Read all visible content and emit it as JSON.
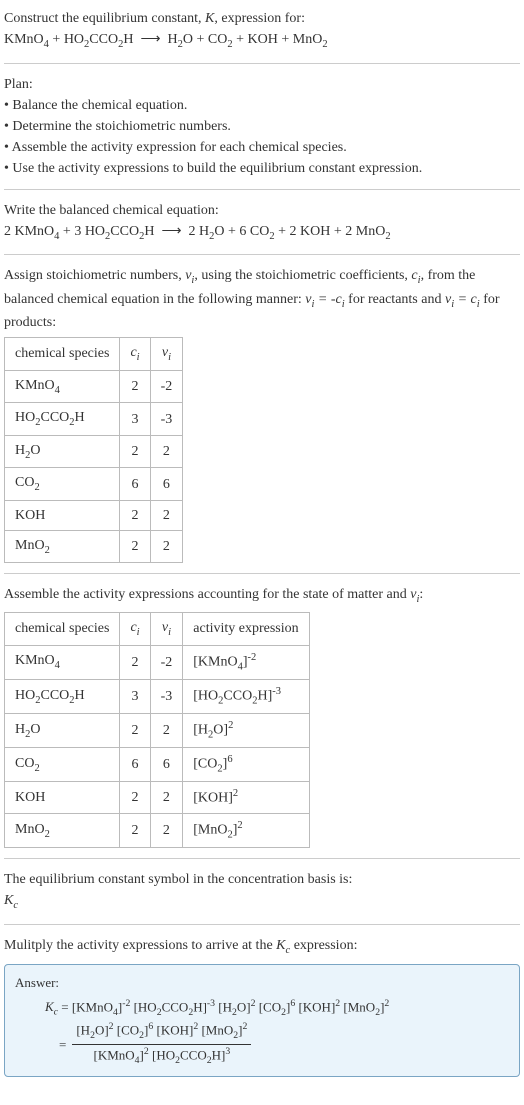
{
  "intro": {
    "line1_pre": "Construct the equilibrium constant, ",
    "line1_k": "K",
    "line1_post": ", expression for:",
    "eq_lhs": "KMnO₄ + HO₂CCO₂H",
    "eq_rhs": "H₂O + CO₂ + KOH + MnO₂"
  },
  "plan": {
    "title": "Plan:",
    "b1": "• Balance the chemical equation.",
    "b2": "• Determine the stoichiometric numbers.",
    "b3": "• Assemble the activity expression for each chemical species.",
    "b4": "• Use the activity expressions to build the equilibrium constant expression."
  },
  "balanced": {
    "title": "Write the balanced chemical equation:",
    "lhs": "2 KMnO₄ + 3 HO₂CCO₂H",
    "rhs": "2 H₂O + 6 CO₂ + 2 KOH + 2 MnO₂"
  },
  "stoich": {
    "intro_a": "Assign stoichiometric numbers, ",
    "intro_b": ", using the stoichiometric coefficients, ",
    "intro_c": ", from the balanced chemical equation in the following manner: ",
    "intro_d": " for reactants and ",
    "intro_e": " for products:",
    "headers": {
      "species": "chemical species",
      "ci": "cᵢ",
      "vi": "νᵢ"
    },
    "rows": [
      {
        "sp": "KMnO₄",
        "c": "2",
        "v": "-2"
      },
      {
        "sp": "HO₂CCO₂H",
        "c": "3",
        "v": "-3"
      },
      {
        "sp": "H₂O",
        "c": "2",
        "v": "2"
      },
      {
        "sp": "CO₂",
        "c": "6",
        "v": "6"
      },
      {
        "sp": "KOH",
        "c": "2",
        "v": "2"
      },
      {
        "sp": "MnO₂",
        "c": "2",
        "v": "2"
      }
    ]
  },
  "activity": {
    "intro_a": "Assemble the activity expressions accounting for the state of matter and ",
    "intro_b": ":",
    "headers": {
      "species": "chemical species",
      "ci": "cᵢ",
      "vi": "νᵢ",
      "act": "activity expression"
    },
    "rows": [
      {
        "sp": "KMnO₄",
        "c": "2",
        "v": "-2",
        "base": "[KMnO₄]",
        "exp": "-2"
      },
      {
        "sp": "HO₂CCO₂H",
        "c": "3",
        "v": "-3",
        "base": "[HO₂CCO₂H]",
        "exp": "-3"
      },
      {
        "sp": "H₂O",
        "c": "2",
        "v": "2",
        "base": "[H₂O]",
        "exp": "2"
      },
      {
        "sp": "CO₂",
        "c": "6",
        "v": "6",
        "base": "[CO₂]",
        "exp": "6"
      },
      {
        "sp": "KOH",
        "c": "2",
        "v": "2",
        "base": "[KOH]",
        "exp": "2"
      },
      {
        "sp": "MnO₂",
        "c": "2",
        "v": "2",
        "base": "[MnO₂]",
        "exp": "2"
      }
    ]
  },
  "kc_symbol": {
    "line": "The equilibrium constant symbol in the concentration basis is:",
    "sym": "K",
    "sub": "c"
  },
  "multiply": {
    "line_a": "Mulitply the activity expressions to arrive at the ",
    "line_b": " expression:"
  },
  "answer": {
    "label": "Answer:",
    "eq_full": "Kc = [KMnO₄]⁻² [HO₂CCO₂H]⁻³ [H₂O]² [CO₂]⁶ [KOH]² [MnO₂]²",
    "numerator": "[H₂O]² [CO₂]⁶ [KOH]² [MnO₂]²",
    "denominator": "[KMnO₄]² [HO₂CCO₂H]³"
  }
}
